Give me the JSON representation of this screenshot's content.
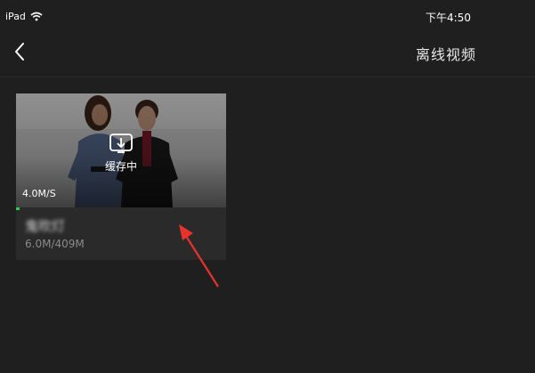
{
  "status_bar": {
    "device": "iPad",
    "time": "下午4:50"
  },
  "nav": {
    "title": "离线视频",
    "back_icon": "chevron-left-icon"
  },
  "video": {
    "status": "缓存中",
    "speed": "4.0M/S",
    "title": "鬼吹灯",
    "size": "6.0M/409M",
    "progress_fraction": 0.015,
    "download_icon": "download-icon"
  },
  "colors": {
    "background": "#1f1f1f",
    "card": "#2a2a2a",
    "progress": "#2ecc40",
    "annotation_arrow": "#e8322c"
  }
}
